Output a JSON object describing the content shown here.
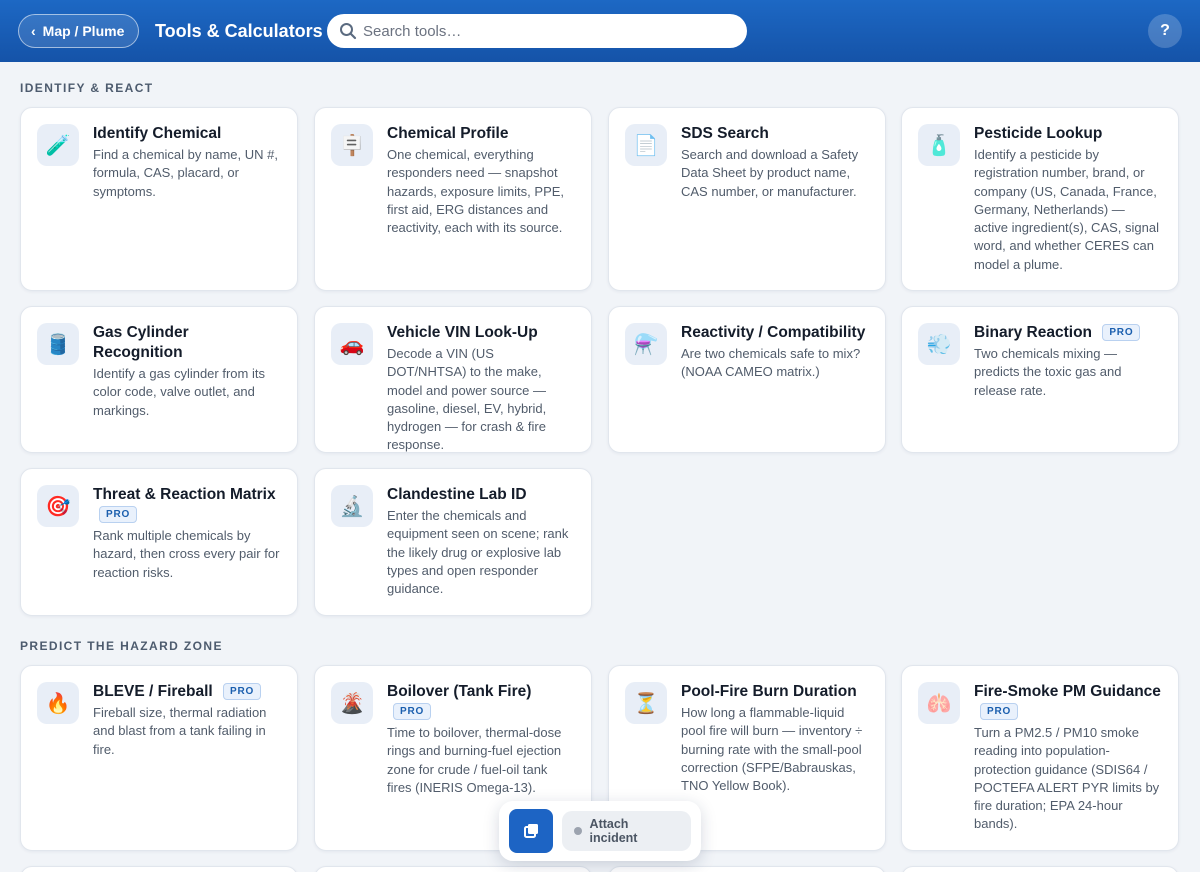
{
  "header": {
    "back_label": "Map / Plume",
    "title": "Tools & Calculators",
    "search_placeholder": "Search tools…",
    "help_label": "?"
  },
  "sections": [
    {
      "label": "IDENTIFY & REACT",
      "cards": [
        {
          "title": "Identify Chemical",
          "pro": false,
          "icon": "test-tube-icon",
          "glyph": "🧪",
          "desc": "Find a chemical by name, UN #, formula, CAS, placard, or symptoms."
        },
        {
          "title": "Chemical Profile",
          "pro": false,
          "icon": "placard-icon",
          "glyph": "🪧",
          "desc": "One chemical, everything responders need — snapshot hazards, exposure limits, PPE, first aid, ERG distances and reactivity, each with its source."
        },
        {
          "title": "SDS Search",
          "pro": false,
          "icon": "document-icon",
          "glyph": "📄",
          "desc": "Search and download a Safety Data Sheet by product name, CAS number, or manufacturer."
        },
        {
          "title": "Pesticide Lookup",
          "pro": false,
          "icon": "spray-bottle-icon",
          "glyph": "🧴",
          "desc": "Identify a pesticide by registration number, brand, or company (US, Canada, France, Germany, Netherlands) — active ingredient(s), CAS, signal word, and whether CERES can model a plume."
        },
        {
          "title": "Gas Cylinder Recognition",
          "pro": false,
          "icon": "cylinder-icon",
          "glyph": "🛢️",
          "desc": "Identify a gas cylinder from its color code, valve outlet, and markings."
        },
        {
          "title": "Vehicle VIN Look-Up",
          "pro": false,
          "icon": "car-icon",
          "glyph": "🚗",
          "desc": "Decode a VIN (US DOT/NHTSA) to the make, model and power source — gasoline, diesel, EV, hybrid, hydrogen — for crash & fire response."
        },
        {
          "title": "Reactivity / Compatibility",
          "pro": false,
          "icon": "flask-icon",
          "glyph": "⚗️",
          "desc": "Are two chemicals safe to mix? (NOAA CAMEO matrix.)"
        },
        {
          "title": "Binary Reaction",
          "pro": true,
          "icon": "gas-cloud-icon",
          "glyph": "💨",
          "desc": "Two chemicals mixing — predicts the toxic gas and release rate."
        },
        {
          "title": "Threat & Reaction Matrix",
          "pro": true,
          "icon": "target-icon",
          "glyph": "🎯",
          "desc": "Rank multiple chemicals by hazard, then cross every pair for reaction risks."
        },
        {
          "title": "Clandestine Lab ID",
          "pro": false,
          "icon": "microscope-icon",
          "glyph": "🔬",
          "desc": "Enter the chemicals and equipment seen on scene; rank the likely drug or explosive lab types and open responder guidance."
        }
      ]
    },
    {
      "label": "PREDICT THE HAZARD ZONE",
      "cards": [
        {
          "title": "BLEVE / Fireball",
          "pro": true,
          "icon": "fire-icon",
          "glyph": "🔥",
          "desc": "Fireball size, thermal radiation and blast from a tank failing in fire."
        },
        {
          "title": "Boilover (Tank Fire)",
          "pro": true,
          "icon": "volcano-icon",
          "glyph": "🌋",
          "desc": "Time to boilover, thermal-dose rings and burning-fuel ejection zone for crude / fuel-oil tank fires (INERIS Omega-13)."
        },
        {
          "title": "Pool-Fire Burn Duration",
          "pro": false,
          "icon": "hourglass-icon",
          "glyph": "⏳",
          "desc": "How long a flammable-liquid pool fire will burn — inventory ÷ burning rate with the small-pool correction (SFPE/Babrauskas, TNO Yellow Book)."
        },
        {
          "title": "Fire-Smoke PM Guidance",
          "pro": true,
          "icon": "lungs-icon",
          "glyph": "🫁",
          "desc": "Turn a PM2.5 / PM10 smoke reading into population-protection guidance (SDIS64 / POCTEFA ALERT PYR limits by fire duration; EPA 24-hour bands)."
        }
      ]
    }
  ],
  "pro_label": "PRO",
  "floating": {
    "attach_label": "Attach incident"
  }
}
